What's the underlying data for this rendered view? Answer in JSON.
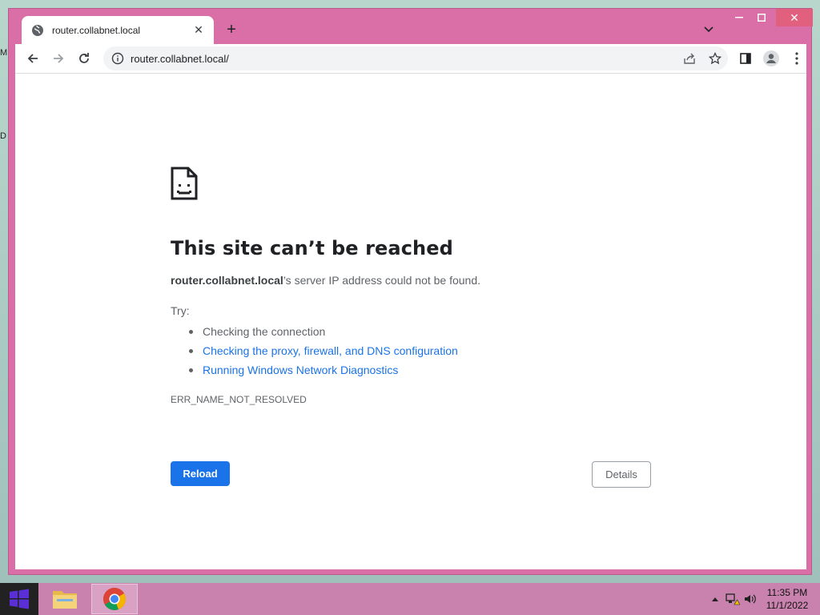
{
  "browser": {
    "tab_title": "router.collabnet.local",
    "url": "router.collabnet.local/"
  },
  "error_page": {
    "title": "This site can’t be reached",
    "host": "router.collabnet.local",
    "desc_suffix": "’s server IP address could not be found.",
    "try_label": "Try:",
    "suggestions": [
      "Checking the connection",
      "Checking the proxy, firewall, and DNS configuration",
      "Running Windows Network Diagnostics"
    ],
    "error_code": "ERR_NAME_NOT_RESOLVED",
    "reload_label": "Reload",
    "details_label": "Details"
  },
  "taskbar": {
    "time": "11:35 PM",
    "date": "11/1/2022"
  },
  "desktop": {
    "edge_letters": [
      "M",
      "D"
    ]
  },
  "colors": {
    "window_frame": "#d96fa6",
    "link": "#1a73e8",
    "reload_button": "#1a73e8",
    "taskbar": "#c882ad"
  }
}
